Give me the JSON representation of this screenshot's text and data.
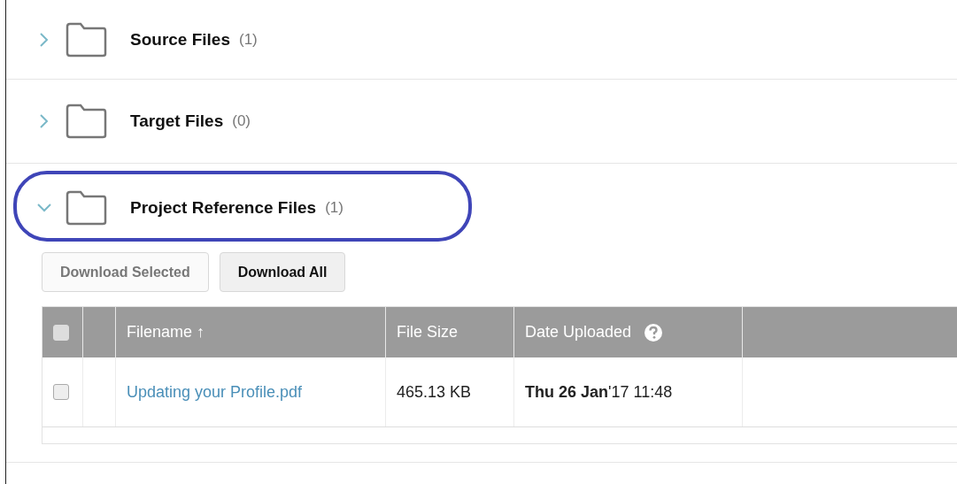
{
  "sections": [
    {
      "name": "Source Files",
      "count": "(1)",
      "expanded": false,
      "highlighted": false
    },
    {
      "name": "Target Files",
      "count": "(0)",
      "expanded": false,
      "highlighted": false
    },
    {
      "name": "Project Reference Files",
      "count": "(1)",
      "expanded": true,
      "highlighted": true
    }
  ],
  "actions": [
    {
      "label": "Download Selected",
      "disabled": true
    },
    {
      "label": "Download All",
      "disabled": false
    }
  ],
  "table": {
    "columns": [
      {
        "kind": "checkbox",
        "checked": false
      },
      {
        "kind": "blank"
      },
      {
        "kind": "text",
        "label": "Filename ↑"
      },
      {
        "kind": "text",
        "label": "File Size"
      },
      {
        "kind": "help",
        "label": "Date Uploaded"
      },
      {
        "kind": "blank"
      }
    ],
    "rows": [
      {
        "checked": false,
        "filename": "Updating your Profile.pdf",
        "size": "465.13 KB",
        "date": "**Thu 26 Jan**'17 11:48"
      }
    ]
  }
}
